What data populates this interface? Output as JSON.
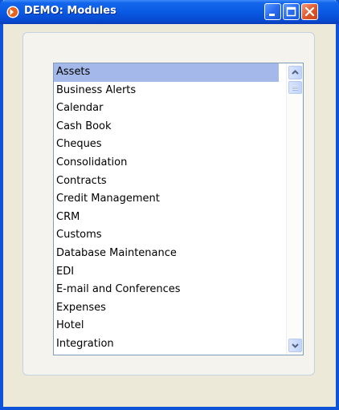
{
  "window": {
    "title": "DEMO: Modules"
  },
  "icons": {
    "app": "app-logo-icon",
    "minimize": "minimize-icon",
    "maximize": "maximize-icon",
    "close": "close-icon",
    "scroll_up": "chevron-up-icon",
    "scroll_down": "chevron-down-icon"
  },
  "colors": {
    "titlebar": "#0a5ae3",
    "selection": "#a4b9ea",
    "close_button": "#e05a2f"
  },
  "modules_list": {
    "selected_index": 0,
    "items": [
      "Assets",
      "Business Alerts",
      "Calendar",
      "Cash Book",
      "Cheques",
      "Consolidation",
      "Contracts",
      "Credit Management",
      "CRM",
      "Customs",
      "Database Maintenance",
      "EDI",
      "E-mail and Conferences",
      "Expenses",
      "Hotel",
      "Integration"
    ]
  }
}
